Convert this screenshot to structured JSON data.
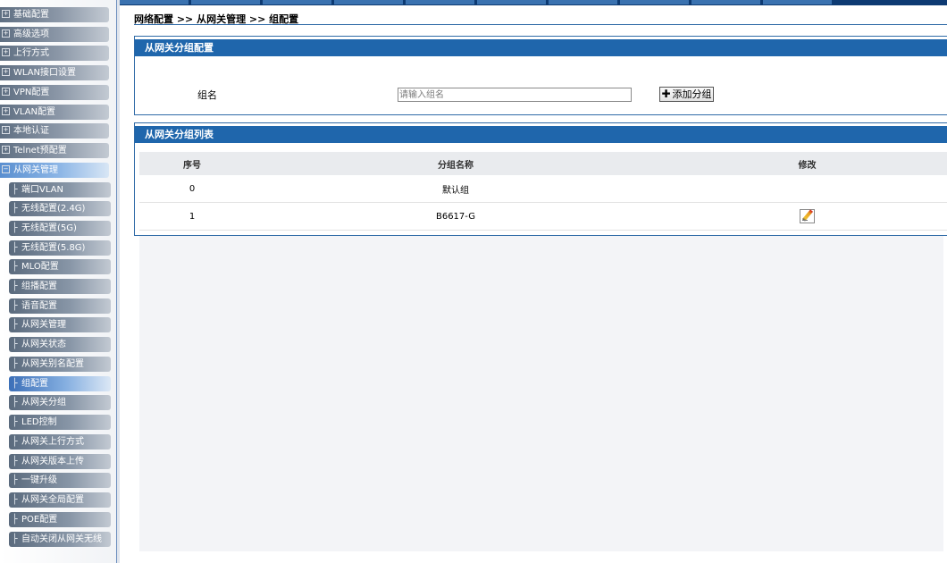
{
  "breadcrumb": "网络配置 >> 从网关管理 >> 组配置",
  "sidebar": {
    "top_items": [
      {
        "icon": "plus-box",
        "label": "基础配置"
      },
      {
        "icon": "plus-box",
        "label": "高级选项"
      },
      {
        "icon": "plus-box",
        "label": "上行方式"
      },
      {
        "icon": "plus-box",
        "label": "WLAN接口设置"
      },
      {
        "icon": "plus-box",
        "label": "VPN配置"
      },
      {
        "icon": "plus-box",
        "label": "VLAN配置"
      },
      {
        "icon": "plus-box",
        "label": "本地认证"
      },
      {
        "icon": "plus-box",
        "label": "Telnet预配置"
      },
      {
        "icon": "minus-box",
        "label": "从网关管理"
      }
    ],
    "sub_items": [
      "端口VLAN",
      "无线配置(2.4G)",
      "无线配置(5G)",
      "无线配置(5.8G)",
      "MLO配置",
      "组播配置",
      "语音配置",
      "从网关管理",
      "从网关状态",
      "从网关别名配置",
      "组配置",
      "从网关分组",
      "LED控制",
      "从网关上行方式",
      "从网关版本上传",
      "一键升级",
      "从网关全局配置",
      "POE配置",
      "自动关闭从网关无线"
    ],
    "active_sub_item": "组配置"
  },
  "group_config": {
    "title": "从网关分组配置",
    "label": "组名",
    "placeholder": "请输入组名",
    "value": "",
    "add_button": "添加分组"
  },
  "group_list": {
    "title": "从网关分组列表",
    "columns": [
      "序号",
      "分组名称",
      "修改"
    ],
    "rows": [
      {
        "index": "0",
        "name": "默认组",
        "editable": false
      },
      {
        "index": "1",
        "name": "B6617-G",
        "editable": true
      }
    ]
  },
  "colors": {
    "panel_header": "#1f66ac",
    "panel_border": "#2f6aa7",
    "active_menu": "#3c6fb8",
    "menu_item": "#6b7a8c"
  }
}
